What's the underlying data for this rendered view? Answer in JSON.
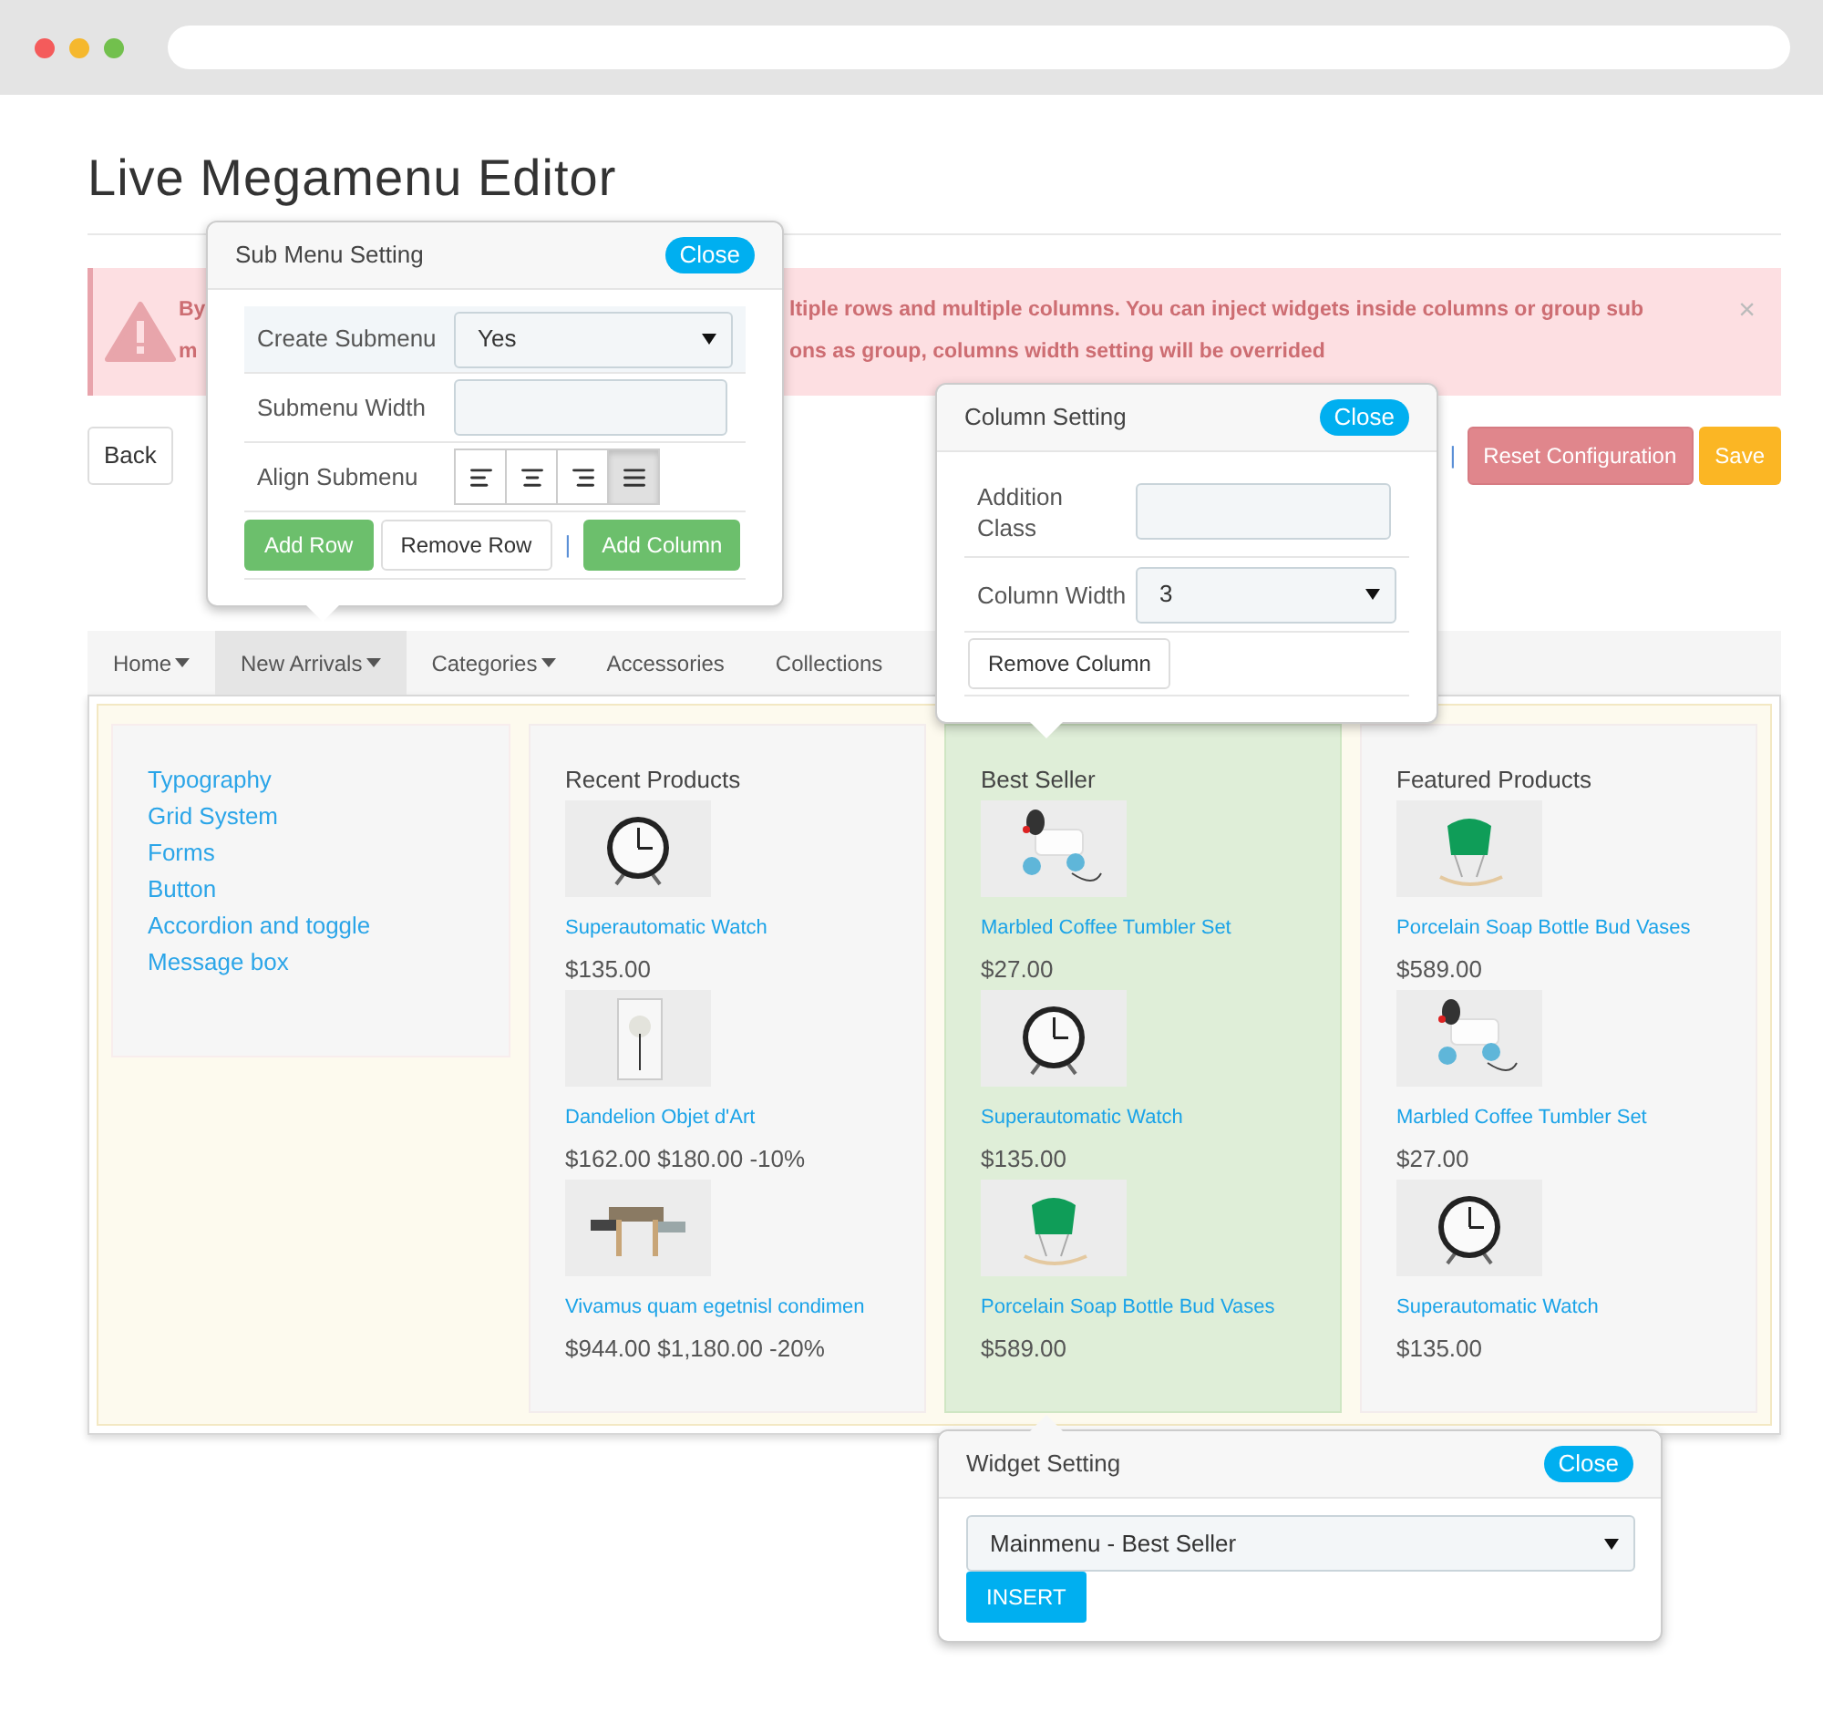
{
  "page_title": "Live Megamenu Editor",
  "alert": {
    "line1_start": "By",
    "line1_end": "ltiple rows and multiple columns. You can inject widgets inside columns or group sub",
    "line2_start": "m",
    "line2_end": "ons as group, columns width setting will be overrided",
    "close": "×"
  },
  "toolbar": {
    "back": "Back",
    "separator": "|",
    "reset": "Reset Configuration",
    "save": "Save"
  },
  "nav": [
    {
      "label": "Home",
      "dropdown": true,
      "selected": false
    },
    {
      "label": "New Arrivals",
      "dropdown": true,
      "selected": true
    },
    {
      "label": "Categories",
      "dropdown": true,
      "selected": false
    },
    {
      "label": "Accessories",
      "dropdown": false,
      "selected": false
    },
    {
      "label": "Collections",
      "dropdown": false,
      "selected": false
    }
  ],
  "megamenu": {
    "links": [
      "Typography",
      "Grid System",
      "Forms",
      "Button",
      "Accordion and toggle",
      "Message box"
    ],
    "columns": [
      {
        "title": "Recent Products",
        "selected": false,
        "products": [
          {
            "name": "Superautomatic Watch",
            "price": "$135.00"
          },
          {
            "name": "Dandelion Objet d'Art",
            "price": "$162.00 $180.00 -10%"
          },
          {
            "name": "Vivamus quam egetnisl condimen",
            "price": "$944.00 $1,180.00 -20%"
          }
        ]
      },
      {
        "title": "Best Seller",
        "selected": true,
        "products": [
          {
            "name": "Marbled Coffee Tumbler Set",
            "price": "$27.00"
          },
          {
            "name": "Superautomatic Watch",
            "price": "$135.00"
          },
          {
            "name": "Porcelain Soap Bottle Bud Vases",
            "price": "$589.00"
          }
        ]
      },
      {
        "title": "Featured Products",
        "selected": false,
        "products": [
          {
            "name": "Porcelain Soap Bottle Bud Vases",
            "price": "$589.00"
          },
          {
            "name": "Marbled Coffee Tumbler Set",
            "price": "$27.00"
          },
          {
            "name": "Superautomatic Watch",
            "price": "$135.00"
          }
        ]
      }
    ]
  },
  "submenu_popup": {
    "title": "Sub Menu Setting",
    "close": "Close",
    "create_label": "Create Submenu",
    "create_value": "Yes",
    "width_label": "Submenu Width",
    "align_label": "Align Submenu",
    "align_options": [
      {
        "kind": "left",
        "selected": false
      },
      {
        "kind": "center",
        "selected": false
      },
      {
        "kind": "right",
        "selected": false
      },
      {
        "kind": "justify",
        "selected": true
      }
    ],
    "add_row": "Add Row",
    "remove_row": "Remove Row",
    "separator": "|",
    "add_column": "Add Column"
  },
  "column_popup": {
    "title": "Column Setting",
    "close": "Close",
    "class_label": "Addition Class",
    "width_label": "Column Width",
    "width_value": "3",
    "remove": "Remove Column"
  },
  "widget_popup": {
    "title": "Widget Setting",
    "close": "Close",
    "widget_value": "Mainmenu - Best Seller",
    "insert": "INSERT"
  }
}
